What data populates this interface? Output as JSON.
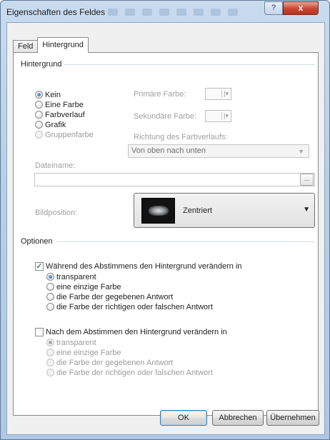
{
  "window": {
    "title": "Eigenschaften des Feldes",
    "help_icon": "?",
    "close_icon": "x"
  },
  "tabs": [
    {
      "label": "Feld",
      "active": false
    },
    {
      "label": "Hintergrund",
      "active": true
    }
  ],
  "background": {
    "group_title": "Hintergrund",
    "options": [
      {
        "label": "Kein",
        "selected": true,
        "disabled": false
      },
      {
        "label": "Eine Farbe",
        "selected": false,
        "disabled": false
      },
      {
        "label": "Farbverlauf",
        "selected": false,
        "disabled": false
      },
      {
        "label": "Grafik",
        "selected": false,
        "disabled": false
      },
      {
        "label": "Gruppenfarbe",
        "selected": false,
        "disabled": true
      }
    ],
    "primary_color_label": "Primäre Farbe:",
    "secondary_color_label": "Sekundäre Farbe:",
    "gradient_direction_label": "Richtung des Farbverlaufs:",
    "gradient_direction_value": "Von oben nach unten",
    "filename_label": "Dateiname:",
    "filename_value": "",
    "browse_label": "...",
    "image_position_label": "Bildposition:",
    "image_position_value": "Zentriert"
  },
  "options": {
    "group_title": "Optionen",
    "during_vote": {
      "label": "Während des Abstimmens den Hintergrund verändern in",
      "checked": true,
      "choices": [
        {
          "label": "transparent",
          "selected": true
        },
        {
          "label": "eine einzige Farbe",
          "selected": false
        },
        {
          "label": "die Farbe der gegebenen Antwort",
          "selected": false
        },
        {
          "label": "die Farbe der richtigen oder falschen Antwort",
          "selected": false
        }
      ]
    },
    "after_vote": {
      "label": "Nach dem Abstimmen den Hintergrund verändern in",
      "checked": false,
      "choices": [
        {
          "label": "transparent",
          "selected": true
        },
        {
          "label": "eine einzige Farbe",
          "selected": false
        },
        {
          "label": "die Farbe der gegebenen Antwort",
          "selected": false
        },
        {
          "label": "die Farbe der richtigen oder falschen Antwort",
          "selected": false
        }
      ]
    }
  },
  "buttons": {
    "ok": "OK",
    "cancel": "Abbrechen",
    "apply": "Übernehmen"
  }
}
